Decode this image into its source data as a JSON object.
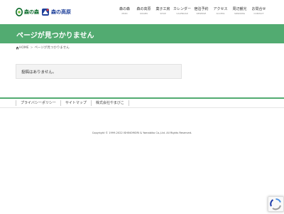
{
  "header": {
    "logo_mori": "森の森",
    "logo_kogen": "森の高原",
    "nav": [
      {
        "ja": "森の森",
        "en": "MORI"
      },
      {
        "ja": "森の高原",
        "en": "KOGEN"
      },
      {
        "ja": "菓子工房",
        "en": "SHOP"
      },
      {
        "ja": "カレンダー",
        "en": "CALENDAR"
      },
      {
        "ja": "宿泊予約",
        "en": "RESERVE"
      },
      {
        "ja": "アクセス",
        "en": "ACCESS"
      },
      {
        "ja": "周辺観光",
        "en": "SPARKING"
      },
      {
        "ja": "お問合せ",
        "en": "CONTACT"
      }
    ]
  },
  "page": {
    "title": "ページが見つかりません",
    "breadcrumb_home": "HOME",
    "breadcrumb_current": "ページが見つかりません",
    "notice": "投稿はありません。"
  },
  "footer": {
    "links": [
      "プライバシーポリシー",
      "サイトマップ",
      "株式会社やまびこ"
    ],
    "copyright": "Copyright © 1999-2022 ISHINOMORI & Yamabiko Co.,Ltd. All Rights Reserved."
  },
  "colors": {
    "brand_green": "#52ab71",
    "logo_green": "#0a6a2a",
    "logo_blue": "#1d3f9a"
  },
  "icons": [
    "mori-logo-icon",
    "kogen-logo-icon",
    "home-icon",
    "recaptcha-icon"
  ]
}
